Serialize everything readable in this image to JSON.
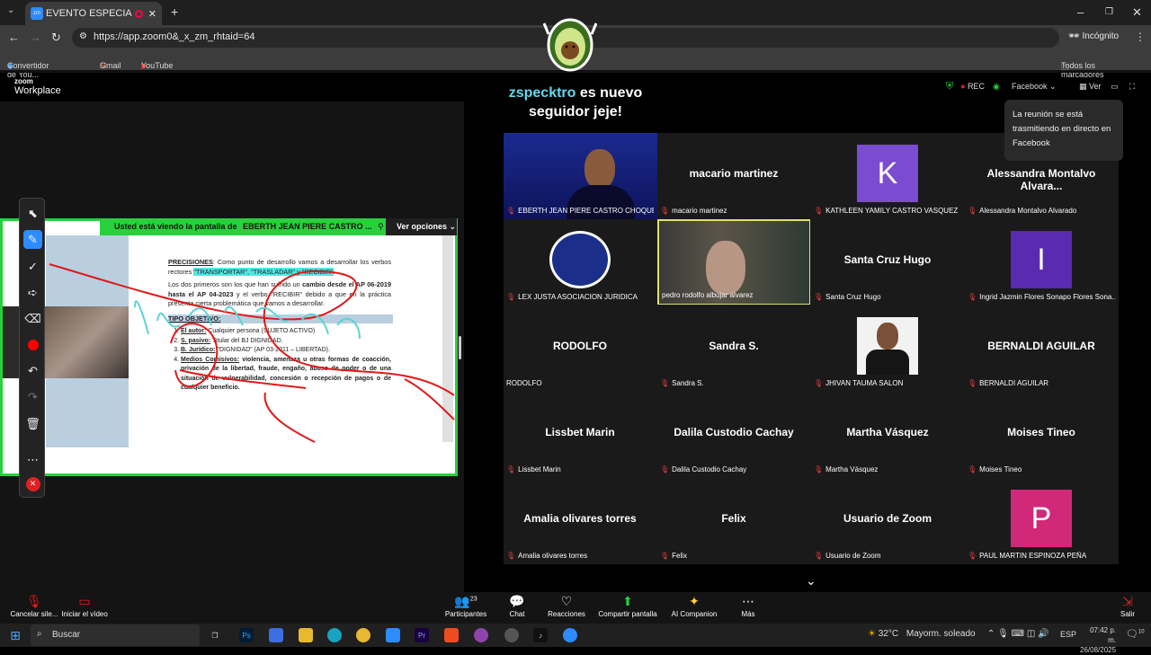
{
  "browser": {
    "tab_title": "EVENTO ESPECIAL SEMA",
    "tab_favicon": "zm",
    "new_tab": "+",
    "url": "https://app.zoom0&_x_zm_rhtaid=64",
    "incognito": "Incógnito",
    "bookmarks": [
      "Convertidor de You...",
      "Gmail",
      "YouTube"
    ],
    "all_bookmarks": "Todos los marcadores"
  },
  "zoom": {
    "logo_top": "zoom",
    "logo_bottom": "Workplace",
    "sharing_notice": "Usted está viendo la pantalla de",
    "sharer_name": "EBERTH JEAN PIERE CASTRO ...",
    "view_options": "Ver opciones",
    "follower_name": "zspecktro",
    "follower_rest": "es nuevo seguidor jeje!",
    "rec": "REC",
    "facebook": "Facebook",
    "view": "Ver",
    "tooltip": "La reunión se está trasmitiendo en directo en Facebook"
  },
  "slide": {
    "precisiones_label": "PRECISIONES",
    "precisiones_text": ": Como punto de desarrollo vamos a desarrollar los verbos rectores ",
    "verbs": "\"TRANSPORTAR\", \"TRASLADAR\" y \"RECIBIR\"",
    "para1_a": "Los dos primeros son los que han sufrido un ",
    "para1_b": "cambio desde el AP 06-2019 hasta el AP 04-2023",
    "para1_c": " y el verbo \"RECIBIR\" debido a que en la práctica presenta cierta problemática que vamos a desarrollar.",
    "tipo": "TIPO OBJETIVO:",
    "items": [
      {
        "label": "El autor:",
        "text": " Cualquier persona (SUJETO ACTIVO)"
      },
      {
        "label": "S. pasivo:",
        "text": " Titular del BJ DIGNIDAD."
      },
      {
        "label": "B. Jurídico:",
        "text": " \"DIGNIDAD\" (AP 03-2011 – LIBERTAD)."
      },
      {
        "label": "Medios Comisivos:",
        "text": " violencia, amenaza u otras formas de coacción, privación de la libertad, fraude, engaño, abuso de poder o de una situación de vulnerabilidad, concesión o recepción de pagos o de cualquier beneficio."
      }
    ]
  },
  "participants": [
    {
      "big": "",
      "label": "EBERTH JEAN PIERE CASTRO CHOQUE",
      "kind": "photo-eberth",
      "muted": true
    },
    {
      "big": "macario martinez",
      "label": "macario martinez",
      "kind": "name",
      "muted": true
    },
    {
      "big": "K",
      "label": "KATHLEEN YAMILY CASTRO VASQUEZ",
      "kind": "avatar",
      "color": "#7b4bd0",
      "muted": true
    },
    {
      "big": "Alessandra Montalvo Alvara...",
      "label": "Alessandra Montalvo Alvarado",
      "kind": "name",
      "muted": true
    },
    {
      "big": "",
      "label": "LEX JUSTA ASOCIACION JURIDICA",
      "kind": "logo",
      "muted": true
    },
    {
      "big": "",
      "label": "pedro rodolfo albujar alvarez",
      "kind": "photo-pedro",
      "muted": false
    },
    {
      "big": "Santa Cruz Hugo",
      "label": "Santa Cruz Hugo",
      "kind": "name",
      "muted": true
    },
    {
      "big": "I",
      "label": "Ingrid Jazmin Flores Sonapo Flores Sona...",
      "kind": "avatar",
      "color": "#5a2ab0",
      "muted": true
    },
    {
      "big": "RODOLFO",
      "label": "RODOLFO",
      "kind": "name",
      "muted": false
    },
    {
      "big": "Sandra S.",
      "label": "Sandra S.",
      "kind": "name",
      "muted": true
    },
    {
      "big": "",
      "label": "JHIVAN TAUMA SALON",
      "kind": "photo-jhivan",
      "muted": true
    },
    {
      "big": "BERNALDI AGUILAR",
      "label": "BERNALDI AGUILAR",
      "kind": "name",
      "muted": true
    },
    {
      "big": "Lissbet Marin",
      "label": "Lissbet Marin",
      "kind": "name",
      "muted": true
    },
    {
      "big": "Dalila Custodio Cachay",
      "label": "Dalila Custodio Cachay",
      "kind": "name",
      "muted": true
    },
    {
      "big": "Martha Vásquez",
      "label": "Martha Vásquez",
      "kind": "name",
      "muted": true
    },
    {
      "big": "Moises Tineo",
      "label": "Moises Tineo",
      "kind": "name",
      "muted": true
    },
    {
      "big": "Amalia olivares torres",
      "label": "Amalia olivares torres",
      "kind": "name",
      "muted": true
    },
    {
      "big": "Felix",
      "label": "Felix",
      "kind": "name",
      "muted": true
    },
    {
      "big": "Usuario de Zoom",
      "label": "Usuario de Zoom",
      "kind": "name",
      "muted": true
    },
    {
      "big": "P",
      "label": "PAUL MARTIN ESPINOZA PEÑA",
      "kind": "avatar",
      "color": "#d1287a",
      "muted": true
    }
  ],
  "bottombar": {
    "mute": "Cancelar sile...",
    "video": "Iniciar el vídeo",
    "participants": "Participantes",
    "participants_count": "23",
    "chat": "Chat",
    "reactions": "Reacciones",
    "share": "Compartir pantalla",
    "ai": "AI Companion",
    "more": "Más",
    "leave": "Salir"
  },
  "taskbar": {
    "search": "Buscar",
    "weather_temp": "32°C",
    "weather_text": "Mayorm. soleado",
    "lang": "ESP",
    "time": "07:42 p. m.",
    "date": "26/08/2025",
    "notif_count": "10"
  },
  "colors": {
    "green": "#28d03c",
    "teal": "#63d9ee",
    "red": "#e02020"
  }
}
